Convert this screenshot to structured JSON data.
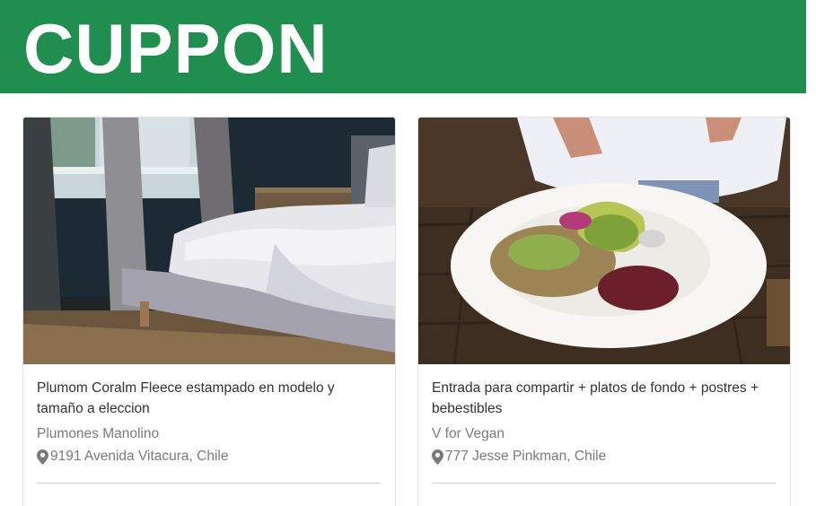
{
  "header": {
    "brand": "CUPPON",
    "accent_color": "#1f8e4f"
  },
  "deals": [
    {
      "title": "Plumom Coralm Fleece estampado en modelo y tamaño a eleccion",
      "merchant": "Plumones Manolino",
      "address": "9191 Avenida Vitacura, Chile",
      "image": "bedroom-photo",
      "location_icon": "map-pin-icon"
    },
    {
      "title": "Entrada para compartir + platos de fondo + postres + bebestibles",
      "merchant": "V for Vegan",
      "address": "777 Jesse Pinkman, Chile",
      "image": "vegan-bowl-photo",
      "location_icon": "map-pin-icon"
    }
  ]
}
